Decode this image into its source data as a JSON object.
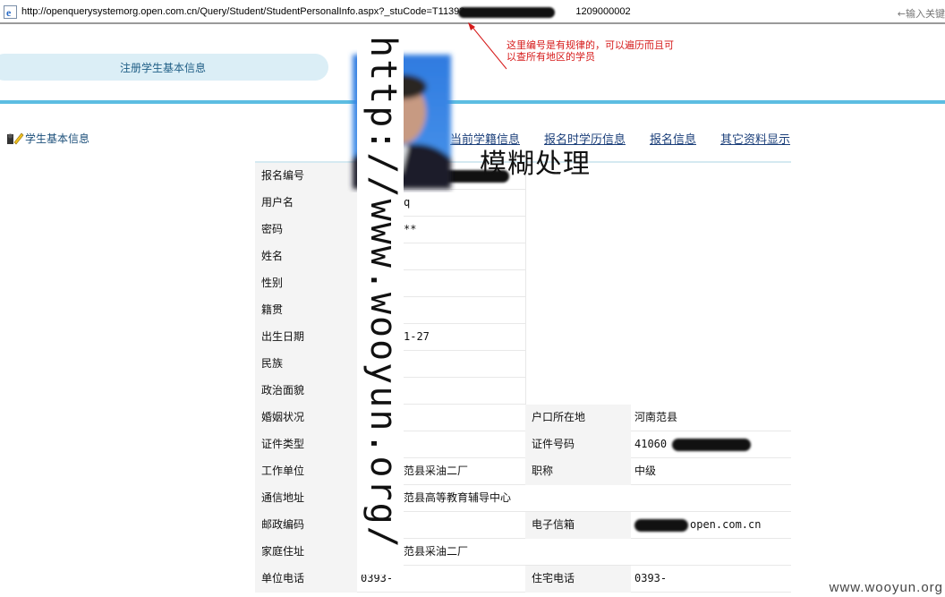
{
  "browser": {
    "url": "http://openquerysystemorg.open.com.cn/Query/Student/StudentPersonalInfo.aspx?_stuCode=T11393",
    "url_tail": "1209000002",
    "search_hint": "←输入关键"
  },
  "annotation": {
    "text": "这里编号是有规律的，可以遍历而且可以查所有地区的学员",
    "color": "#d61a1a"
  },
  "header": {
    "pill_label": "注册学生基本信息"
  },
  "sidebar": {
    "items": [
      {
        "label": "学生基本信息",
        "icon": "user-edit-icon"
      }
    ]
  },
  "tabs": [
    {
      "label": "信息"
    },
    {
      "label": "当前学籍信息"
    },
    {
      "label": "报名时学历信息"
    },
    {
      "label": "报名信息"
    },
    {
      "label": "其它资料显示"
    }
  ],
  "form": {
    "rows": [
      {
        "label": "报名编号",
        "value": ""
      },
      {
        "label": "用户名",
        "value": "q"
      },
      {
        "label": "密码",
        "value": "**"
      },
      {
        "label": "姓名",
        "value": ""
      },
      {
        "label": "性别",
        "value": ""
      },
      {
        "label": "籍贯",
        "value": ""
      },
      {
        "label": "出生日期",
        "value": "1-27"
      },
      {
        "label": "民族",
        "value": ""
      },
      {
        "label": "政治面貌",
        "value": ""
      }
    ],
    "pair_rows": [
      {
        "label": "婚姻状况",
        "value": "",
        "label2": "户口所在地",
        "value2": "河南范县"
      },
      {
        "label": "证件类型",
        "value": "",
        "label2": "证件号码",
        "value2": "41060"
      },
      {
        "label": "工作单位",
        "value": "范县采油二厂",
        "label2": "职称",
        "value2": "中级"
      },
      {
        "label": "通信地址",
        "value": "范县高等教育辅导中心",
        "label2": "",
        "value2": ""
      },
      {
        "label": "邮政编码",
        "value": "",
        "label2": "电子信箱",
        "value2": "open.com.cn"
      },
      {
        "label": "家庭住址",
        "value": "范县采油二厂",
        "label2": "",
        "value2": ""
      },
      {
        "label": "单位电话",
        "value": "0393-",
        "label2": "住宅电话",
        "value2": "0393-"
      }
    ],
    "photo_caption": "模糊处理"
  },
  "watermark": {
    "vertical": "http://www.wooyun.org/",
    "corner": "www.wooyun.org"
  }
}
